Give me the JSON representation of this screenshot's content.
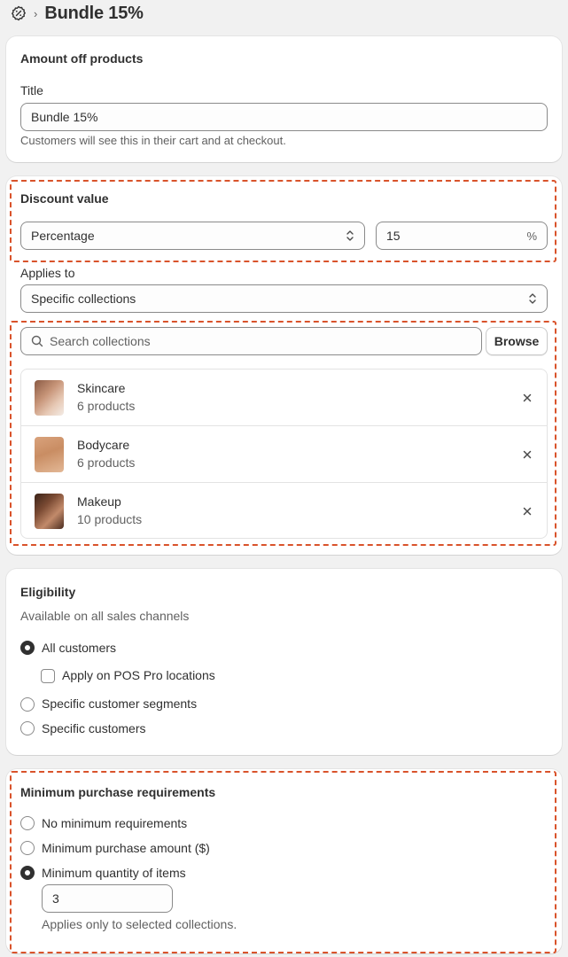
{
  "header": {
    "title": "Bundle 15%",
    "icon": "discount-icon"
  },
  "amount_card": {
    "title": "Amount off products",
    "title_label": "Title",
    "title_value": "Bundle 15%",
    "help": "Customers will see this in their cart and at checkout."
  },
  "discount_card": {
    "title": "Discount value",
    "type_value": "Percentage",
    "amount_value": "15",
    "amount_suffix": "%",
    "applies_label": "Applies to",
    "applies_value": "Specific collections",
    "search_placeholder": "Search collections",
    "browse_label": "Browse",
    "collections": [
      {
        "name": "Skincare",
        "count": "6 products"
      },
      {
        "name": "Bodycare",
        "count": "6 products"
      },
      {
        "name": "Makeup",
        "count": "10 products"
      }
    ]
  },
  "eligibility_card": {
    "title": "Eligibility",
    "subtitle": "Available on all sales channels",
    "options": {
      "all_customers": "All customers",
      "pos_pro": "Apply on POS Pro locations",
      "segments": "Specific customer segments",
      "specific": "Specific customers"
    },
    "selected": "all_customers",
    "pos_pro_checked": false
  },
  "minimum_card": {
    "title": "Minimum purchase requirements",
    "options": {
      "none": "No minimum requirements",
      "amount": "Minimum purchase amount ($)",
      "quantity": "Minimum quantity of items"
    },
    "selected": "quantity",
    "quantity_value": "3",
    "help": "Applies only to selected collections."
  },
  "colors": {
    "highlight": "#d9532b",
    "text": "#303030",
    "subdued": "#616161",
    "page_bg": "#f1f1f1"
  }
}
